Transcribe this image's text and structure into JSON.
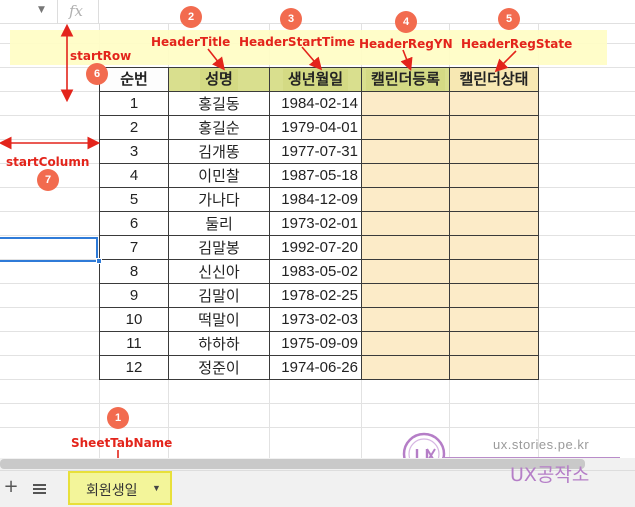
{
  "formula_bar": {
    "fx": "fx"
  },
  "table": {
    "headers": [
      "순번",
      "성명",
      "생년월일",
      "캘린더등록",
      "캘린더상태"
    ],
    "rows": [
      [
        "1",
        "홍길동",
        "1984-02-14",
        "",
        ""
      ],
      [
        "2",
        "홍길순",
        "1979-04-01",
        "",
        ""
      ],
      [
        "3",
        "김개똥",
        "1977-07-31",
        "",
        ""
      ],
      [
        "4",
        "이민찰",
        "1987-05-18",
        "",
        ""
      ],
      [
        "5",
        "가나다",
        "1984-12-09",
        "",
        ""
      ],
      [
        "6",
        "둘리",
        "1973-02-01",
        "",
        ""
      ],
      [
        "7",
        "김말봉",
        "1992-07-20",
        "",
        ""
      ],
      [
        "8",
        "신신아",
        "1983-05-02",
        "",
        ""
      ],
      [
        "9",
        "김말이",
        "1978-02-25",
        "",
        ""
      ],
      [
        "10",
        "떡말이",
        "1973-02-03",
        "",
        ""
      ],
      [
        "11",
        "하하하",
        "1975-09-09",
        "",
        ""
      ],
      [
        "12",
        "정준이",
        "1974-06-26",
        "",
        ""
      ]
    ]
  },
  "annotations": {
    "sheet_tab_name": {
      "num": "1",
      "label": "SheetTabName"
    },
    "header_title": {
      "num": "2",
      "label": "HeaderTitle"
    },
    "header_start_time": {
      "num": "3",
      "label": "HeaderStartTime"
    },
    "header_reg_yn": {
      "num": "4",
      "label": "HeaderRegYN"
    },
    "header_reg_state": {
      "num": "5",
      "label": "HeaderRegState"
    },
    "start_row": {
      "num": "6",
      "label": "startRow"
    },
    "start_column": {
      "num": "7",
      "label": "startColumn"
    }
  },
  "sheet_bar": {
    "add_icon": "+",
    "tab_name": "회원생일",
    "tab_arrow": "▼"
  },
  "watermark": {
    "url": "ux.stories.pe.kr",
    "name": "UX공작소"
  },
  "colors": {
    "annotation_red": "#e3241b",
    "annotation_circle": "#f26b4f",
    "header_highlight": "#d9df8e",
    "reg_cell": "#fcebc8",
    "selection_blue": "#2f7bd8",
    "tab_highlight": "#f3f59a"
  }
}
